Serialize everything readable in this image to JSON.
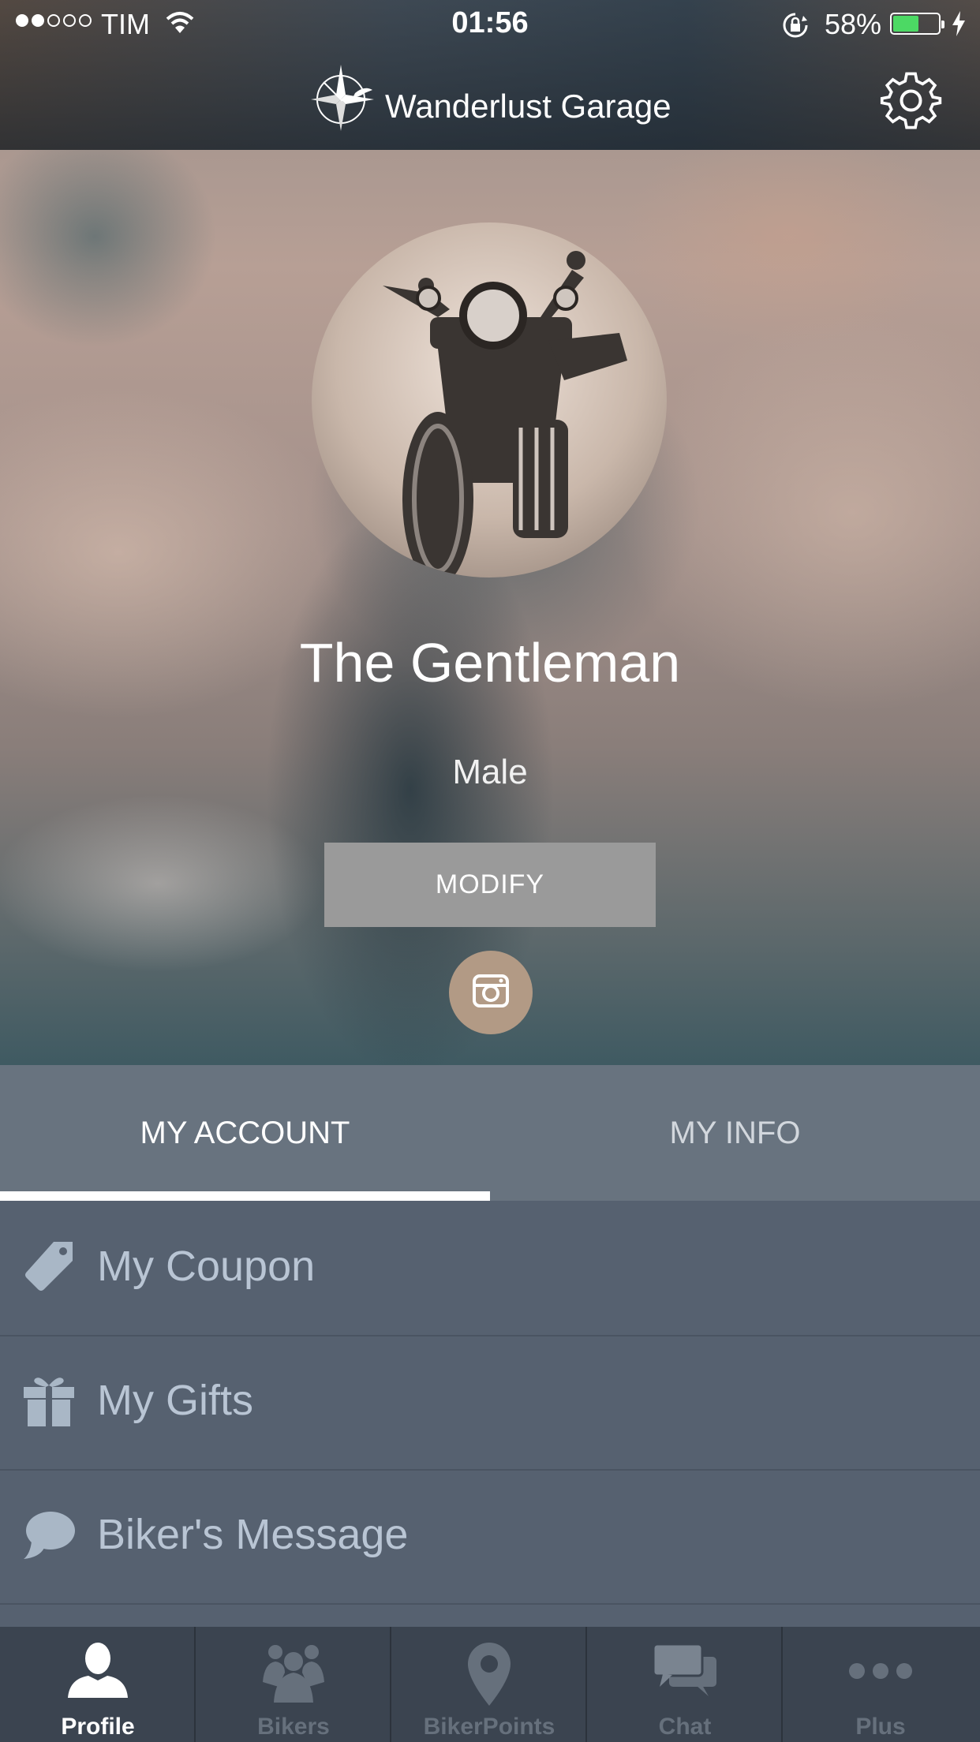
{
  "status_bar": {
    "carrier": "TIM",
    "time": "01:56",
    "battery_percent": "58%",
    "battery_level": 0.58,
    "signal_bars": 2
  },
  "header": {
    "app_name": "Wanderlust Garage",
    "logo_icon": "compass-rose-icon",
    "settings_icon": "gear-icon"
  },
  "profile": {
    "name": "The Gentleman",
    "gender": "Male",
    "modify_label": "MODIFY",
    "camera_icon": "camera-icon"
  },
  "tabs": [
    {
      "label": "MY ACCOUNT",
      "active": true
    },
    {
      "label": "MY INFO",
      "active": false
    }
  ],
  "menu": [
    {
      "label": "My Coupon",
      "icon": "tag-icon"
    },
    {
      "label": "My Gifts",
      "icon": "gift-icon"
    },
    {
      "label": "Biker's Message",
      "icon": "speech-bubble-icon"
    }
  ],
  "tabbar": [
    {
      "label": "Profile",
      "icon": "person-icon",
      "active": true
    },
    {
      "label": "Bikers",
      "icon": "group-icon",
      "active": false
    },
    {
      "label": "BikerPoints",
      "icon": "location-pin-icon",
      "active": false
    },
    {
      "label": "Chat",
      "icon": "chat-bubbles-icon",
      "active": false
    },
    {
      "label": "Plus",
      "icon": "more-dots-icon",
      "active": false
    }
  ],
  "colors": {
    "tab_bg": "#68737f",
    "list_bg": "#566170",
    "tabbar_bg": "#3b4450",
    "camera_button": "#b29a85",
    "battery_fill": "#4cd964"
  }
}
